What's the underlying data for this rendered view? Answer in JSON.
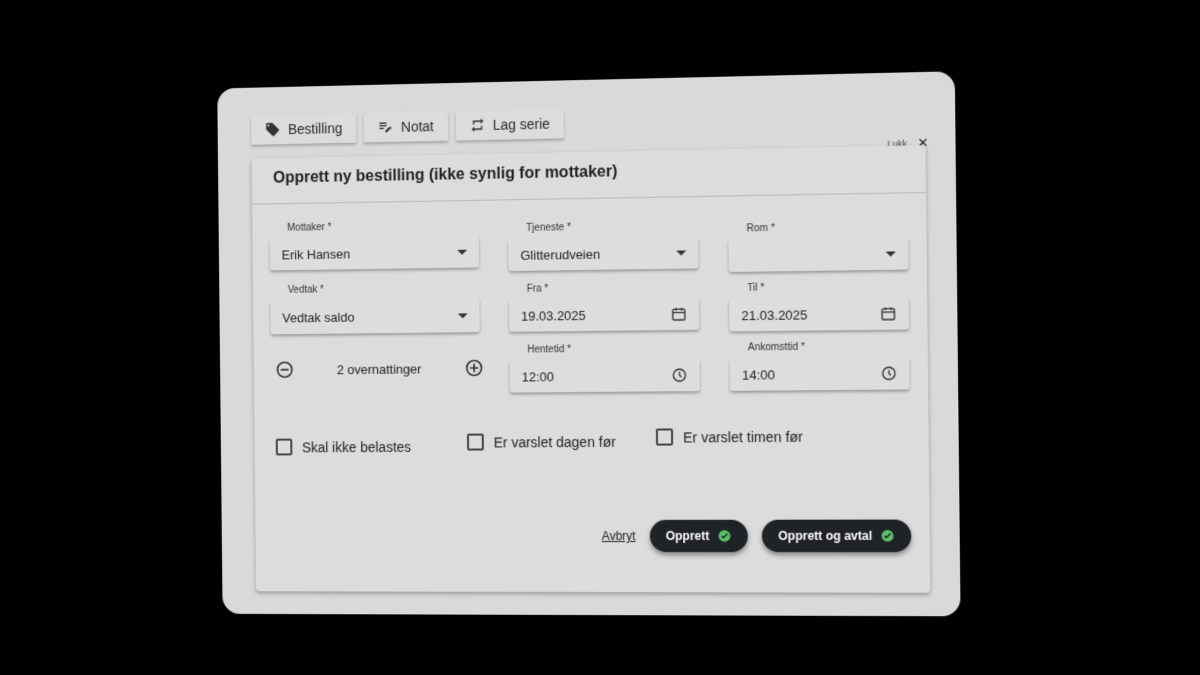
{
  "tabs": [
    {
      "label": "Bestilling",
      "icon": "tag-icon"
    },
    {
      "label": "Notat",
      "icon": "note-edit-icon"
    },
    {
      "label": "Lag serie",
      "icon": "repeat-icon"
    }
  ],
  "close": {
    "label": "Lukk"
  },
  "panel": {
    "title": "Opprett ny bestilling (ikke synlig for mottaker)"
  },
  "fields": {
    "mottaker": {
      "label": "Mottaker *",
      "value": "Erik Hansen"
    },
    "tjeneste": {
      "label": "Tjeneste *",
      "value": "Glitterudveien"
    },
    "rom": {
      "label": "Rom *",
      "value": ""
    },
    "vedtak": {
      "label": "Vedtak *",
      "value": "Vedtak saldo"
    },
    "fra": {
      "label": "Fra *",
      "value": "19.03.2025"
    },
    "til": {
      "label": "Til *",
      "value": "21.03.2025"
    },
    "hentetid": {
      "label": "Hentetid *",
      "value": "12:00"
    },
    "ankomsttid": {
      "label": "Ankomsttid *",
      "value": "14:00"
    }
  },
  "stepper": {
    "value": "2 overnattinger"
  },
  "checkboxes": [
    {
      "label": "Skal ikke belastes",
      "checked": false
    },
    {
      "label": "Er varslet dagen før",
      "checked": false
    },
    {
      "label": "Er varslet timen før",
      "checked": false
    }
  ],
  "actions": {
    "cancel": "Avbryt",
    "create": "Opprett",
    "create_and_book": "Opprett og avtal"
  },
  "colors": {
    "button_bg": "#1f2227",
    "check_green": "#5cc06a",
    "card_bg": "#d9d9d9"
  }
}
